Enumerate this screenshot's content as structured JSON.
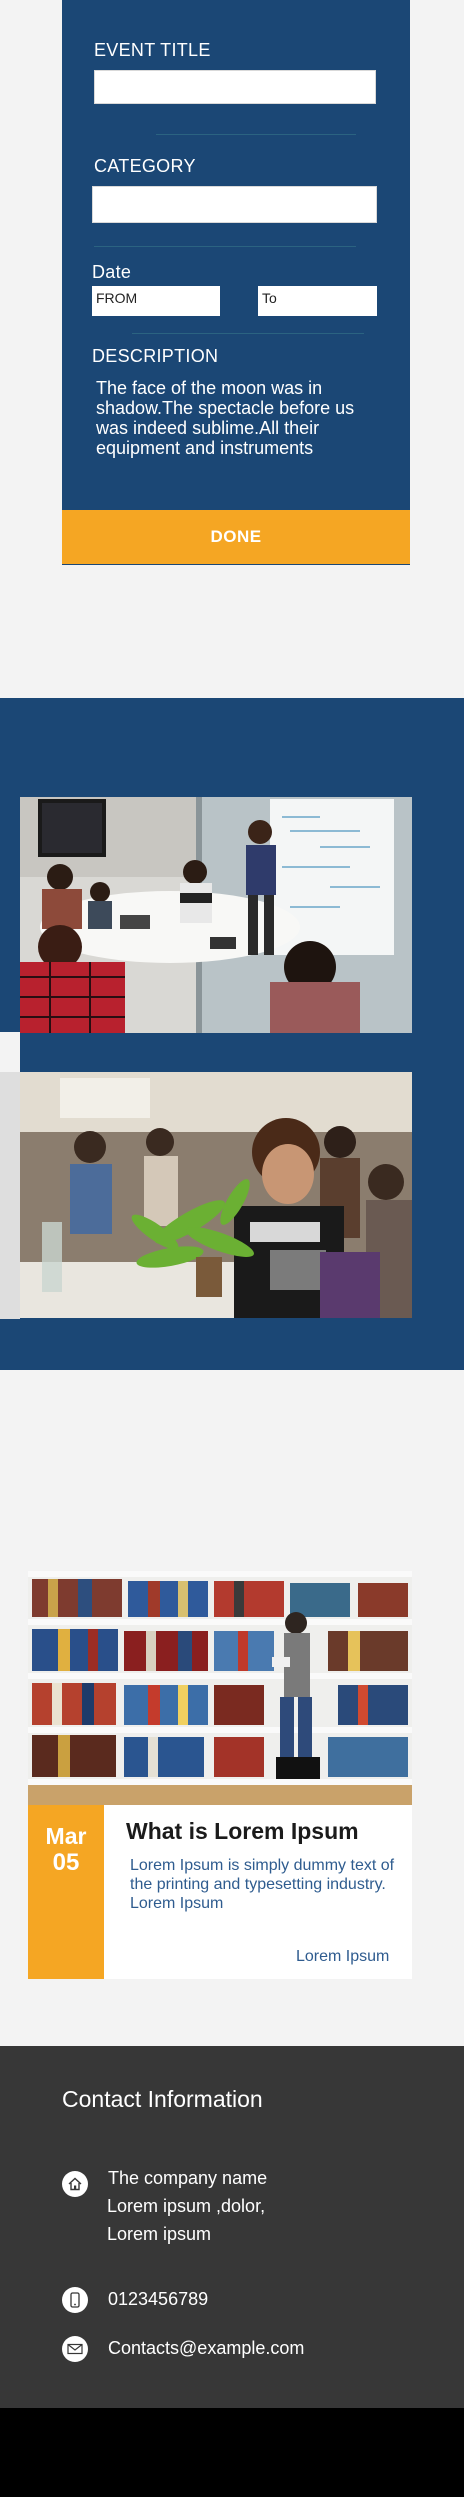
{
  "event_form": {
    "event_title_label": "EVENT TITLE",
    "event_title_value": "",
    "category_label": "CATEGORY",
    "category_value": "",
    "date_label": "Date",
    "from_value": "FROM",
    "to_value": "To",
    "description_label": "DESCRIPTION",
    "description_text": "The face of the moon was in shadow.The spectacle before us was indeed sublime.All their equipment and instruments",
    "done_label": "DONE"
  },
  "gallery": {
    "background": "#1b4775",
    "photos": [
      {
        "icon": "meeting-photo"
      },
      {
        "icon": "student-photo"
      }
    ]
  },
  "blog_card": {
    "date_month": "Mar",
    "date_day": "05",
    "title": "What is Lorem Ipsum",
    "excerpt": "Lorem Ipsum is simply dummy text of the printing and typesetting industry. Lorem Ipsum",
    "link_label": "Lorem Ipsum"
  },
  "contact": {
    "title": "Contact Information",
    "address_line_1": "The company name",
    "address_line_2": "Lorem ipsum ,dolor,",
    "address_line_3": "Lorem ipsum",
    "phone": "0123456789",
    "email": "Contacts@example.com"
  },
  "colors": {
    "primary_blue": "#1b4775",
    "accent_orange": "#f5a623",
    "dark_footer": "#373737",
    "link_blue": "#2f5c8f"
  }
}
